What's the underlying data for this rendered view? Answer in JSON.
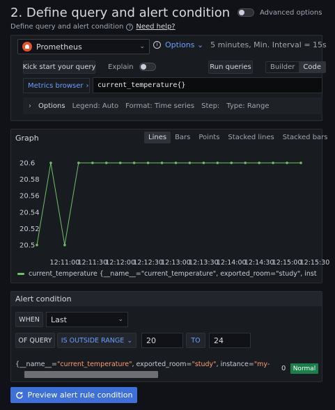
{
  "header": {
    "title": "2. Define query and alert condition",
    "subtitle": "Define query and alert condition",
    "help_link": "Need help?",
    "advanced_options_label": "Advanced options"
  },
  "query": {
    "datasource": "Prometheus",
    "options_link": "Options",
    "interval_text": "5 minutes, Min. Interval = 15s",
    "kick_start_label": "Kick start your query",
    "explain_label": "Explain",
    "run_queries_label": "Run queries",
    "mode_builder": "Builder",
    "mode_code": "Code",
    "metrics_browser_label": "Metrics browser",
    "expression": "current_temperature{}",
    "options_row": {
      "label": "Options",
      "legend": "Legend: Auto",
      "format": "Format: Time series",
      "step": "Step:",
      "type": "Type: Range"
    }
  },
  "graph": {
    "title": "Graph",
    "viz_options": [
      "Lines",
      "Bars",
      "Points",
      "Stacked lines",
      "Stacked bars"
    ],
    "active_viz": "Lines",
    "legend_text": "current_temperature {__name__=\"current_temperature\", exported_room=\"study\", instance=\"my-"
  },
  "chart_data": {
    "type": "line",
    "x": [
      "12:10:30",
      "12:10:45",
      "12:11:00",
      "12:11:15",
      "12:11:30",
      "12:11:45",
      "12:12:00",
      "12:12:15",
      "12:12:30",
      "12:12:45",
      "12:13:00",
      "12:13:15",
      "12:13:30",
      "12:13:45",
      "12:14:00",
      "12:14:15",
      "12:14:30",
      "12:14:45",
      "12:15:00",
      "12:15:15"
    ],
    "series": [
      {
        "name": "current_temperature",
        "values": [
          20.5,
          20.6,
          20.5,
          20.6,
          20.6,
          20.6,
          20.6,
          20.6,
          20.6,
          20.6,
          20.6,
          20.6,
          20.6,
          20.6,
          20.6,
          20.6,
          20.6,
          20.6,
          20.6,
          20.6
        ]
      }
    ],
    "x_ticks": [
      "12:11:00",
      "12:11:30",
      "12:12:00",
      "12:12:30",
      "12:13:00",
      "12:13:30",
      "12:14:00",
      "12:14:30",
      "12:15:00",
      "12:15:30"
    ],
    "y_ticks": [
      "20.6",
      "20.58",
      "20.56",
      "20.54",
      "20.52",
      "20.5"
    ],
    "ylim": [
      20.5,
      20.6
    ],
    "color": "#73bf69",
    "grid": false,
    "legend": "bottom"
  },
  "alert": {
    "title": "Alert condition",
    "when_label": "WHEN",
    "reducer": "Last",
    "of_query_label": "OF QUERY",
    "evaluator": "IS OUTSIDE RANGE",
    "from_value": "20",
    "to_label": "TO",
    "to_value": "24",
    "series_labels": [
      {
        "key": "__name__",
        "value": "\"current_temperature\""
      },
      {
        "key": "exported_room",
        "value": "\"study\""
      },
      {
        "key": "instance",
        "value": "\"my-"
      }
    ],
    "series_value": "0",
    "state": "Normal"
  },
  "footer": {
    "preview_label": "Preview alert rule condition"
  },
  "colors": {
    "accent": "#6e9fff",
    "primary_button": "#3d71d9",
    "series": "#73bf69",
    "normal_badge": "#1a7f4b",
    "label_value": "#ff9c73"
  }
}
